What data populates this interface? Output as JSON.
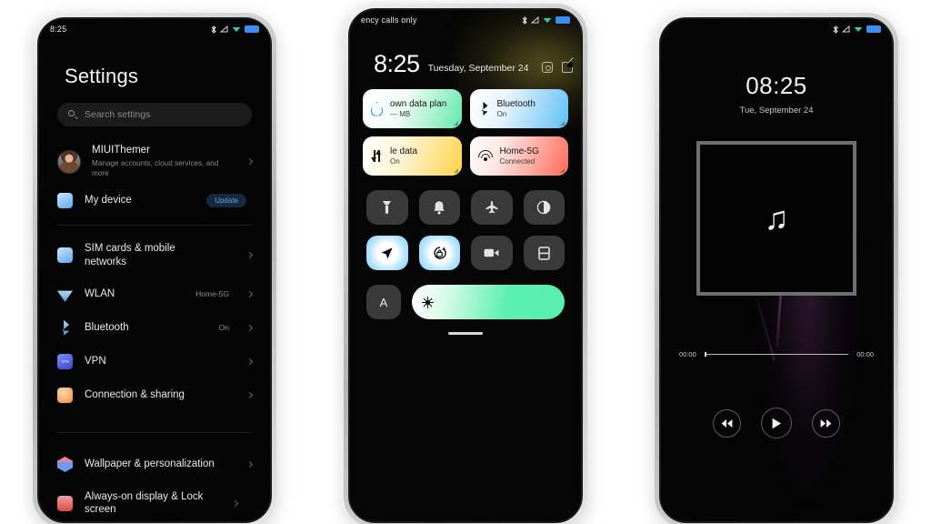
{
  "phone1": {
    "name": "settings-phone",
    "statusbar": {
      "time": "8:25",
      "icons": [
        "bluetooth-icon",
        "signal-icon",
        "wifi-icon",
        "battery-icon"
      ]
    },
    "title": "Settings",
    "search": {
      "placeholder": "Search settings",
      "icon": "search-icon"
    },
    "profile": {
      "name": "MIUIThemer",
      "subtitle": "Manage accounts, cloud services, and more"
    },
    "device": {
      "label": "My device",
      "badge": "Update"
    },
    "items": [
      {
        "label": "SIM cards & mobile networks",
        "value": "",
        "icon": "sim-icon"
      },
      {
        "label": "WLAN",
        "value": "Home-5G",
        "icon": "wlan-icon"
      },
      {
        "label": "Bluetooth",
        "value": "On",
        "icon": "bluetooth-icon"
      },
      {
        "label": "VPN",
        "value": "",
        "icon": "vpn-icon"
      },
      {
        "label": "Connection & sharing",
        "value": "",
        "icon": "connection-sharing-icon"
      }
    ],
    "items2": [
      {
        "label": "Wallpaper & personalization",
        "value": "",
        "icon": "wallpaper-icon"
      },
      {
        "label": "Always-on display & Lock screen",
        "value": "",
        "icon": "aod-lockscreen-icon"
      }
    ]
  },
  "phone2": {
    "name": "control-center-phone",
    "statusbar": {
      "carrier": "ency calls only",
      "icons": [
        "bluetooth-icon",
        "signal-icon",
        "wifi-icon",
        "battery-icon"
      ]
    },
    "clock": {
      "time": "8:25",
      "date": "Tuesday, September 24"
    },
    "actions": [
      "settings-gear-icon",
      "edit-icon"
    ],
    "big_tiles": [
      {
        "title": "own data plan",
        "sub": "--- MB",
        "icon": "data-drop-icon",
        "color": "#63e9ad"
      },
      {
        "title": "Bluetooth",
        "sub": "On",
        "icon": "bluetooth-icon",
        "color": "#5fc0f5"
      },
      {
        "title": "le data",
        "sub": "On",
        "icon": "mobile-data-icon",
        "color": "#ffd24a"
      },
      {
        "title": "Home-5G",
        "sub": "Connected",
        "icon": "wifi-icon",
        "color": "#ff6a5a"
      }
    ],
    "small_tiles": [
      {
        "name": "flashlight-icon",
        "glyph": "🔦",
        "on": false
      },
      {
        "name": "silent-bell-icon",
        "glyph": "🔔",
        "on": false
      },
      {
        "name": "airplane-mode-icon",
        "glyph": "✈",
        "on": false
      },
      {
        "name": "dark-mode-icon",
        "glyph": "◑",
        "on": false
      },
      {
        "name": "location-icon",
        "glyph": "➤",
        "on": true
      },
      {
        "name": "auto-rotate-icon",
        "glyph": "↻",
        "on": true
      },
      {
        "name": "screen-recorder-icon",
        "glyph": "📹",
        "on": false
      },
      {
        "name": "screenshot-icon",
        "glyph": "⌸",
        "on": false
      }
    ],
    "brightness": {
      "auto_label": "A",
      "icon": "brightness-sun-icon",
      "level": 100
    }
  },
  "phone3": {
    "name": "lockscreen-player-phone",
    "statusbar": {
      "icons": [
        "bluetooth-icon",
        "signal-icon",
        "wifi-icon",
        "battery-icon"
      ]
    },
    "clock": {
      "time": "08:25",
      "date": "Tue, September 24"
    },
    "album": {
      "icon": "music-note-icon",
      "glyph": "♫"
    },
    "progress": {
      "elapsed": "00:00",
      "total": "00:00",
      "percent": 0
    },
    "controls": [
      {
        "name": "previous-button",
        "glyph": "◀◀"
      },
      {
        "name": "play-button",
        "glyph": "▶"
      },
      {
        "name": "next-button",
        "glyph": "▶▶"
      }
    ]
  }
}
